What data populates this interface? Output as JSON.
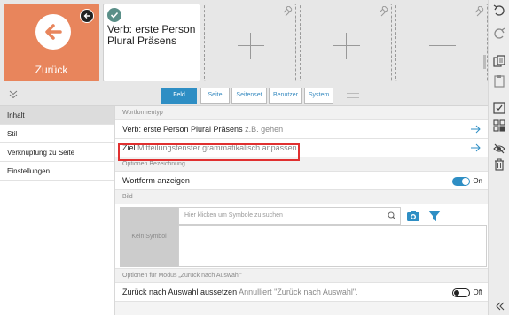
{
  "top_tiles": {
    "back_tile": {
      "label": "Zurück"
    },
    "verb_tile": {
      "label": "Verb: erste Person Plural Präsens"
    },
    "empty_tiles_count": 3
  },
  "tabs": [
    {
      "label": "Feld",
      "active": true
    },
    {
      "label": "Seite",
      "active": false
    },
    {
      "label": "Seitenset",
      "active": false
    },
    {
      "label": "Benutzer",
      "active": false
    },
    {
      "label": "System",
      "active": false
    }
  ],
  "left_nav": [
    {
      "label": "Inhalt",
      "active": true
    },
    {
      "label": "Stil",
      "active": false
    },
    {
      "label": "Verknüpfung zu Seite",
      "active": false
    },
    {
      "label": "Einstellungen",
      "active": false
    }
  ],
  "sections": {
    "wortformentyp": {
      "header": "Wortformentyp",
      "verb_row": {
        "label": "Verb: erste Person Plural Präsens",
        "example": "z.B. gehen"
      },
      "ziel_row": {
        "label": "Ziel",
        "value": "Mitteilungsfenster grammatikalisch anpassen"
      }
    },
    "bezeichnung": {
      "header": "Optionen Bezeichnung",
      "wortform_row": {
        "label": "Wortform anzeigen",
        "toggle": "On"
      }
    },
    "bild": {
      "header": "Bild",
      "no_symbol": "Kein Symbol",
      "search_placeholder": "Hier klicken um Symbole zu suchen"
    },
    "zurueck_modus": {
      "header": "Optionen für Modus „Zurück nach Auswahl“",
      "row": {
        "label": "Zurück nach Auswahl aussetzen",
        "note": "Annulliert \"Zurück nach Auswahl\".",
        "toggle": "Off"
      }
    }
  },
  "colors": {
    "accent": "#2e8ec4",
    "back_tile": "#e8855c",
    "highlight": "#e03030",
    "check": "#5a8f88"
  },
  "icons": {
    "right_toolbar": [
      "undo-icon",
      "redo-icon",
      "copy-icon",
      "paste-icon",
      "select-icon",
      "grid-icon",
      "hide-icon",
      "delete-icon",
      "expand-icon"
    ]
  }
}
